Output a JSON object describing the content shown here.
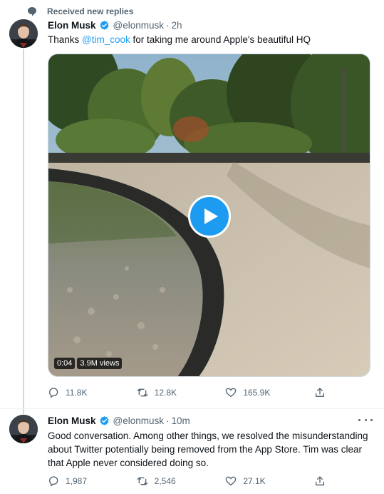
{
  "context_header": {
    "label": "Received new replies",
    "icon": "speech-bubble-icon"
  },
  "tweets": [
    {
      "author_name": "Elon Musk",
      "author_handle": "@elonmusk",
      "time_sep": "·",
      "time": "2h",
      "text_before": "Thanks ",
      "mention": "@tim_cook",
      "text_after": " for taking me around Apple's beautiful HQ",
      "video": {
        "duration": "0:04",
        "views": "3.9M views"
      },
      "metrics": {
        "replies": "11.8K",
        "retweets": "12.8K",
        "likes": "165.9K"
      }
    },
    {
      "author_name": "Elon Musk",
      "author_handle": "@elonmusk",
      "time_sep": "·",
      "time": "10m",
      "lines": [
        "Good conversation. Among other things, we resolved the misunderstanding",
        "about Twitter potentially being removed from the App Store. Tim was clear",
        "that Apple never considered doing so."
      ],
      "metrics": {
        "replies": "1,987",
        "retweets": "2,546",
        "likes": "27.1K"
      }
    }
  ],
  "colors": {
    "accent": "#1d9bf0",
    "text": "#0f1419",
    "secondary": "#536471",
    "border": "#cfd9de"
  }
}
